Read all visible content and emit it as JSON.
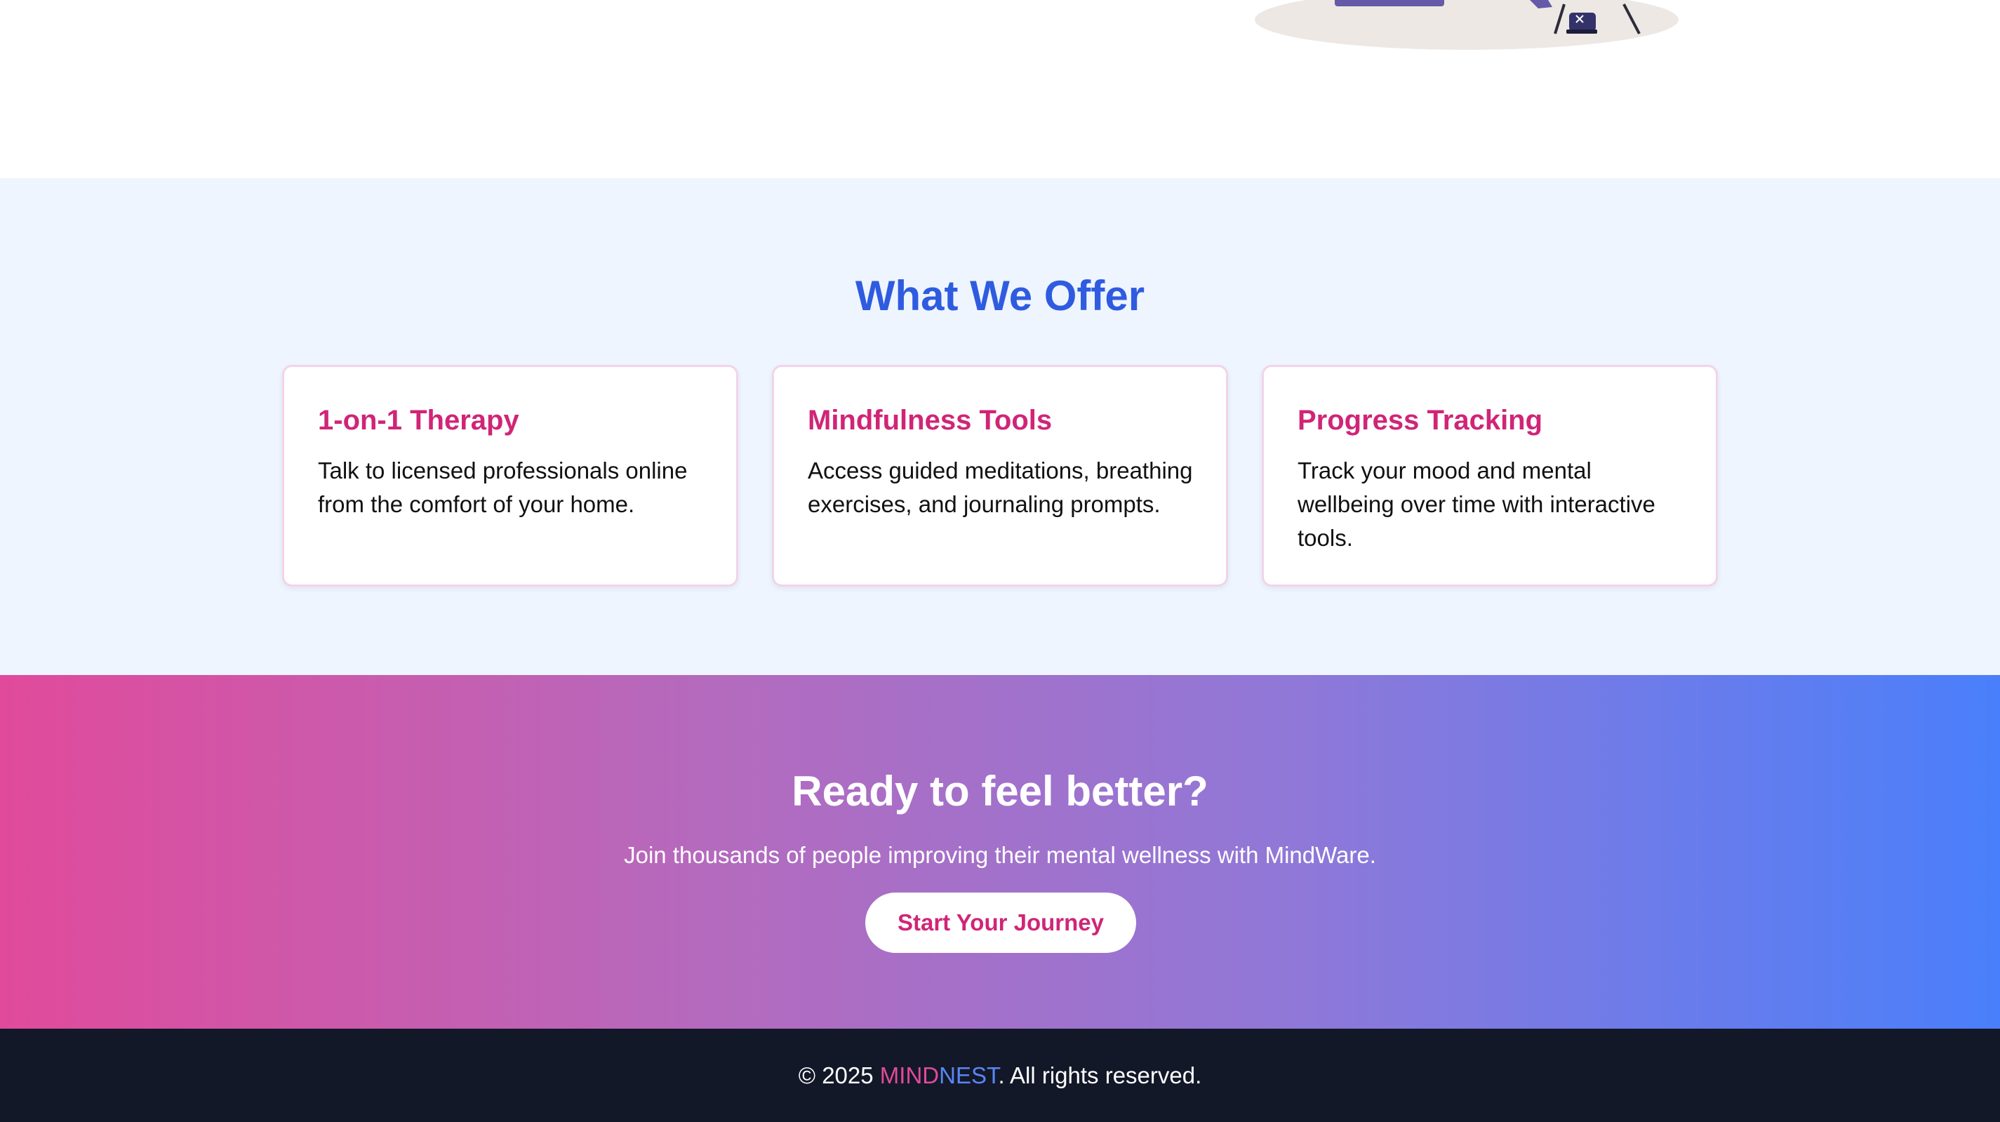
{
  "offer": {
    "title": "What We Offer",
    "cards": [
      {
        "title": "1-on-1 Therapy",
        "text": "Talk to licensed professionals online from the comfort of your home."
      },
      {
        "title": "Mindfulness Tools",
        "text": "Access guided meditations, breathing exercises, and journaling prompts."
      },
      {
        "title": "Progress Tracking",
        "text": "Track your mood and mental wellbeing over time with interactive tools."
      }
    ]
  },
  "cta": {
    "title": "Ready to feel better?",
    "text": "Join thousands of people improving their mental wellness with MindWare.",
    "button_label": "Start Your Journey"
  },
  "footer": {
    "prefix": "© 2025 ",
    "brand_mind": "MIND",
    "brand_nest": "NEST",
    "suffix": ". All rights reserved."
  },
  "colors": {
    "heading_blue": "#2f5be0",
    "accent_pink": "#d02577",
    "offer_background": "#eef5fe",
    "footer_background": "#121828",
    "gradient_start": "#e14a9b",
    "gradient_end": "#4a7ffb"
  },
  "icons": {
    "hero_illustration": "person-at-laptop-illustration"
  }
}
